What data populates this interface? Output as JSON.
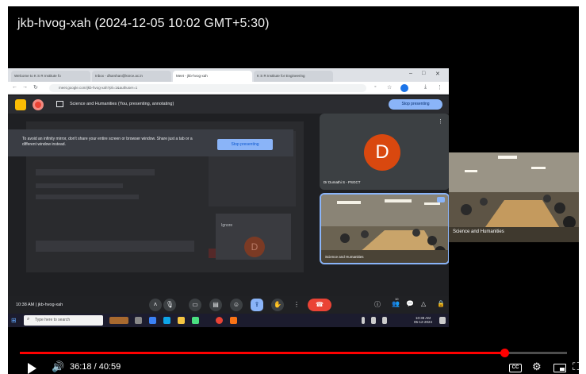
{
  "video": {
    "title": "jkb-hvog-xah (2024-12-05 10:02 GMT+5:30)",
    "current_time": "36:18",
    "duration": "40:59",
    "time_display": "36:18 / 40:59",
    "progress_fraction": 0.885
  },
  "browser": {
    "tabs": [
      {
        "label": "Welcome to K S R Institute fo"
      },
      {
        "label": "Inbox - dharshan@ksrce.ac.in"
      },
      {
        "label": "Meet - jkb-hvog-xah",
        "active": true
      },
      {
        "label": "K S R Institute for Engineering"
      }
    ],
    "url": "meet.google.com/jkb-hvog-xah?pli=1&authuser=1",
    "window_controls": [
      "–",
      "□",
      "✕"
    ]
  },
  "meet": {
    "presenting_banner": "Science and Humanities (You, presenting, annotating)",
    "stop_presenting_label": "Stop presenting",
    "warning_text": "To avoid an infinity mirror, don't share your entire screen or browser window. Share just a tab or a different window instead.",
    "mini_tile_label": "Ignore",
    "participant_initial": "D",
    "participant_name": "Dr Dumathi S - PSGCT",
    "room_tile_name": "Science and Humanities",
    "clock_label": "10:38 AM | jkb-hvog-xah",
    "people_count": "10",
    "side_tile_name": "Science and Humanities"
  },
  "taskbar": {
    "search_placeholder": "Type here to search",
    "clock": "10:38 AM",
    "date": "05-12-2024"
  },
  "colors": {
    "progress": "#ff0000",
    "avatar": "#d9480f",
    "accent_blue": "#8ab4f8",
    "end_call": "#ea4335"
  }
}
